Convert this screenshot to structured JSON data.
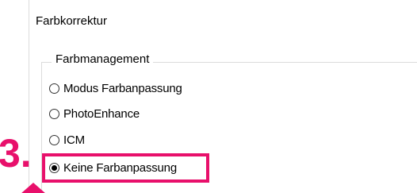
{
  "dialog": {
    "title": "Farbkorrektur"
  },
  "color_management": {
    "legend": "Farbmanagement",
    "options": [
      {
        "label": "Modus Farbanpassung",
        "selected": false
      },
      {
        "label": "PhotoEnhance",
        "selected": false
      },
      {
        "label": "ICM",
        "selected": false
      },
      {
        "label": "Keine Farbanpassung",
        "selected": true
      }
    ]
  },
  "annotation": {
    "step_label": "3.",
    "color": "#e8106b"
  }
}
